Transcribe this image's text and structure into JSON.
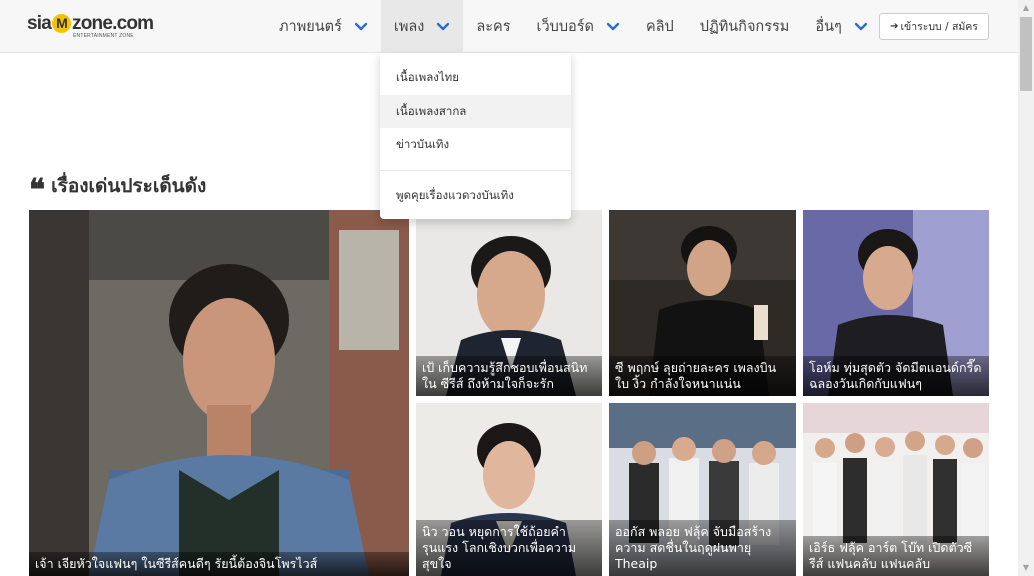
{
  "logo": {
    "brand": "sia",
    "m": "M",
    "brand_rest": "zone.com",
    "tagline": "ENTERTAINMENT ZONE"
  },
  "nav": {
    "items": [
      {
        "label": "ภาพยนตร์",
        "has_dropdown": true
      },
      {
        "label": "เพลง",
        "has_dropdown": true,
        "active": true
      },
      {
        "label": "ละคร",
        "has_dropdown": false
      },
      {
        "label": "เว็บบอร์ด",
        "has_dropdown": true
      },
      {
        "label": "คลิป",
        "has_dropdown": false
      },
      {
        "label": "ปฏิทินกิจกรรม",
        "has_dropdown": false
      },
      {
        "label": "อื่นๆ",
        "has_dropdown": true
      }
    ],
    "login_label": "เข้าระบบ / สมัคร",
    "login_icon": "sign-in-icon"
  },
  "dropdown": {
    "items": [
      {
        "label": "เนื้อเพลงไทย"
      },
      {
        "label": "เนื้อเพลงสากล",
        "hovered": true
      },
      {
        "label": "ข่าวบันเทิง"
      },
      {
        "label": "พูดคุยเรื่องแวดวงบันเทิง"
      }
    ]
  },
  "section": {
    "icon": "quote-icon",
    "title": "เรื่องเด่นประเด็นดัง"
  },
  "cards": [
    {
      "caption": "เจ้า เจียหัวใจแฟนๆ ในซีรีส์คนดีๆ รัยนี้ต้องจินโพรไวส์"
    },
    {
      "caption": "เป้ เก็บความรู้สึกชอบเพื่อนสนิทใน ซีรีส์ ถึงห้ามใจก็จะรัก"
    },
    {
      "caption": "ซี พฤกษ์ ลุยถ่ายละคร เพลงบินใบ งิ้ว กำลังใจหนาแน่น"
    },
    {
      "caption": "โอห์ม ทุ่มสุดตัว จัดมีตแอนด์กรี๊ด ฉลองวันเกิดกับแฟนๆ"
    },
    {
      "caption": "นิว วอน หยุดการใช้ถ้อยคำรุนแรง โลกเชิงบวกเพื่อความสุขใจ"
    },
    {
      "caption": "ออกัส พลอย ฟลุ้ค จับมือสร้างความ สดชื่นในฤดูฝนพายุ Theaip"
    },
    {
      "caption": "เอิร์ธ ฟลุ้ค อาร์ต โบ๊ท เปิดตัวซีรีส์ แฟนคลับ แฟนคลับ"
    }
  ],
  "colors": {
    "navbar_bg": "#f7f7f7",
    "chevron": "#2a6fc9",
    "logo_accent": "#f3c300"
  }
}
